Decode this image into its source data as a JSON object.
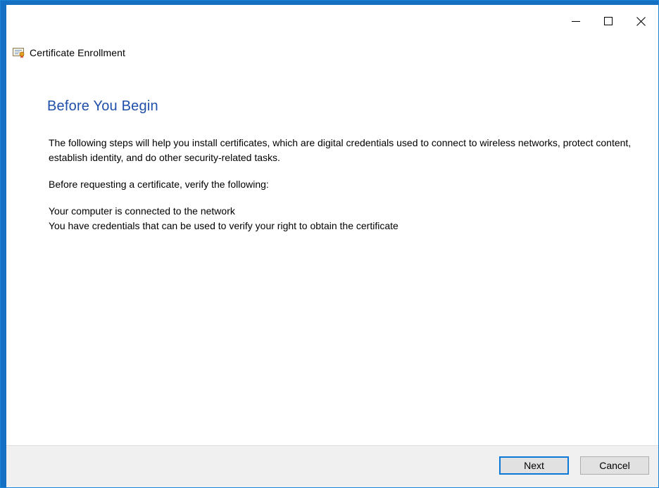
{
  "window": {
    "title": "Certificate Enrollment",
    "accent_color": "#1570c4",
    "caption_buttons": {
      "minimize_icon": "minimize-icon",
      "maximize_icon": "maximize-icon",
      "close_icon": "close-icon"
    }
  },
  "page": {
    "heading": "Before You Begin",
    "heading_color": "#1f4fa8",
    "intro": "The following steps will help you install certificates, which are digital credentials used to connect to wireless networks, protect content, establish identity, and do other security-related tasks.",
    "verify_prompt": "Before requesting a certificate, verify the following:",
    "requirements": [
      "Your computer is connected to the network",
      "You have credentials that can be used to verify your right to obtain the certificate"
    ]
  },
  "footer": {
    "next_label": "Next",
    "cancel_label": "Cancel"
  }
}
